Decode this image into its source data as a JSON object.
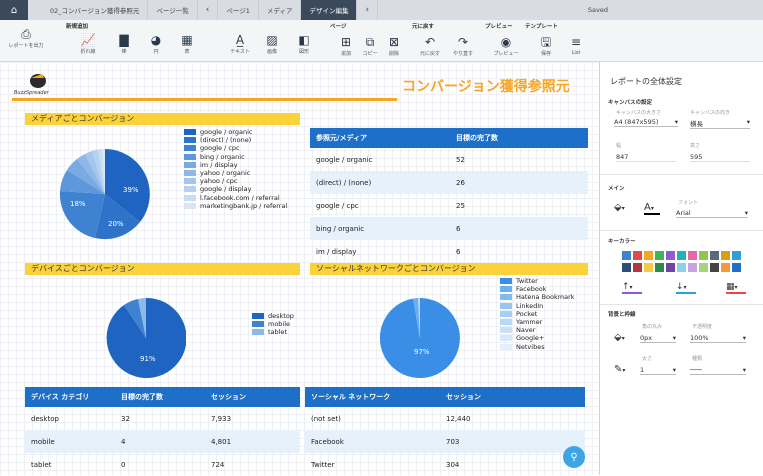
{
  "topbar": {
    "home_icon": "home-icon",
    "tabs": [
      "02_コンバージョン獲得参照元",
      "ページ一覧",
      "‹",
      "ページ1",
      "メディア",
      "デザイン編集",
      "›"
    ],
    "status": "Saved"
  },
  "ribbon": {
    "groups": [
      "新規追加",
      "ページ",
      "元に戻す",
      "プレビュー",
      "テンプレート"
    ],
    "buttons": [
      "レポートを出力",
      "折れ線",
      "棒",
      "円",
      "表",
      "テキスト",
      "画像",
      "図形",
      "追加",
      "コピー",
      "削除",
      "元に戻す",
      "やり直す",
      "プレビュー",
      "保存",
      "List"
    ]
  },
  "brand": "BuzzSpreader",
  "report_title": "コンバージョン獲得参照元",
  "sections": {
    "media": "メディアごとコンバージョン",
    "device": "デバイスごとコンバージョン",
    "social": "ソーシャルネットワークごとコンバージョン"
  },
  "media_legend": [
    "google / organic",
    "(direct) / (none)",
    "google / cpc",
    "bing / organic",
    "im / display",
    "yahoo / organic",
    "yahoo / cpc",
    "google / display",
    "l.facebook.com / referral",
    "marketingbank.jp / referral"
  ],
  "media_pie_labels": [
    "39%",
    "20%",
    "18%"
  ],
  "media_table": {
    "headers": [
      "参照元/メディア",
      "目標の完了数"
    ],
    "rows": [
      [
        "google / organic",
        "52"
      ],
      [
        "(direct) / (none)",
        "26"
      ],
      [
        "google / cpc",
        "25"
      ],
      [
        "bing / organic",
        "6"
      ],
      [
        "im / display",
        "6"
      ]
    ]
  },
  "device_legend": [
    "desktop",
    "mobile",
    "tablet"
  ],
  "device_pie_label": "91%",
  "device_table": {
    "headers": [
      "デバイス カテゴリ",
      "目標の完了数",
      "セッション"
    ],
    "rows": [
      [
        "desktop",
        "32",
        "7,933"
      ],
      [
        "mobile",
        "4",
        "4,801"
      ],
      [
        "tablet",
        "0",
        "724"
      ]
    ]
  },
  "social_legend": [
    "Twitter",
    "Facebook",
    "Hatena Bookmark",
    "LinkedIn",
    "Pocket",
    "Yammer",
    "Naver",
    "Google+",
    "Netvibes"
  ],
  "social_pie_label": "97%",
  "social_table": {
    "headers": [
      "ソーシャル ネットワーク",
      "セッション"
    ],
    "rows": [
      [
        "(not set)",
        "12,440"
      ],
      [
        "Facebook",
        "703"
      ],
      [
        "Twitter",
        "304"
      ]
    ]
  },
  "side": {
    "title": "レポートの全体設定",
    "canvas_settings": "キャンバスの設定",
    "canvas_size_label": "キャンバスの大きさ",
    "canvas_size": "A4 (847x595)",
    "canvas_orient_label": "キャンバスの向き",
    "canvas_orient": "横長",
    "width_label": "幅",
    "width": "847",
    "height_label": "高さ",
    "height": "595",
    "main": "メイン",
    "font_label": "フォント",
    "font": "Arial",
    "key_color": "キーカラー",
    "bg_border": "背景と枠線",
    "radius_label": "角の丸み",
    "radius": "0px",
    "opacity_label": "不透明度",
    "opacity": "100%",
    "thick_label": "太さ",
    "thick": "1",
    "line_label": "種類"
  },
  "colors": {
    "accent": "#1e6fc8",
    "yellow": "#fbd23a",
    "title_orange": "#f6a623"
  }
}
